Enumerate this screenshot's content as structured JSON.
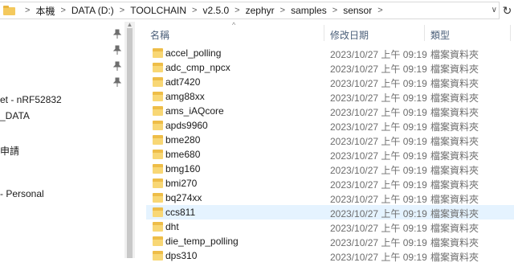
{
  "address_bar": {
    "crumbs": [
      "本機",
      "DATA (D:)",
      "TOOLCHAIN",
      "v2.5.0",
      "zephyr",
      "samples",
      "sensor"
    ],
    "separator": ">",
    "dropdown_glyph": "∨",
    "refresh_glyph": "↻"
  },
  "nav_pane": {
    "items": [
      {
        "label": "et - nRF52832"
      },
      {
        "label": "_DATA"
      },
      {
        "label": "申請"
      },
      {
        "label": "- Personal"
      }
    ],
    "pin_glyph": "📌"
  },
  "columns": {
    "name": "名稱",
    "modified": "修改日期",
    "type": "類型",
    "sort_glyph": "^"
  },
  "files": [
    {
      "name": "accel_polling",
      "modified": "2023/10/27 上午 09:19",
      "type": "檔案資料夾"
    },
    {
      "name": "adc_cmp_npcx",
      "modified": "2023/10/27 上午 09:19",
      "type": "檔案資料夾"
    },
    {
      "name": "adt7420",
      "modified": "2023/10/27 上午 09:19",
      "type": "檔案資料夾"
    },
    {
      "name": "amg88xx",
      "modified": "2023/10/27 上午 09:19",
      "type": "檔案資料夾"
    },
    {
      "name": "ams_iAQcore",
      "modified": "2023/10/27 上午 09:19",
      "type": "檔案資料夾"
    },
    {
      "name": "apds9960",
      "modified": "2023/10/27 上午 09:19",
      "type": "檔案資料夾"
    },
    {
      "name": "bme280",
      "modified": "2023/10/27 上午 09:19",
      "type": "檔案資料夾"
    },
    {
      "name": "bme680",
      "modified": "2023/10/27 上午 09:19",
      "type": "檔案資料夾"
    },
    {
      "name": "bmg160",
      "modified": "2023/10/27 上午 09:19",
      "type": "檔案資料夾"
    },
    {
      "name": "bmi270",
      "modified": "2023/10/27 上午 09:19",
      "type": "檔案資料夾"
    },
    {
      "name": "bq274xx",
      "modified": "2023/10/27 上午 09:19",
      "type": "檔案資料夾"
    },
    {
      "name": "ccs811",
      "modified": "2023/10/27 上午 09:19",
      "type": "檔案資料夾"
    },
    {
      "name": "dht",
      "modified": "2023/10/27 上午 09:19",
      "type": "檔案資料夾"
    },
    {
      "name": "die_temp_polling",
      "modified": "2023/10/27 上午 09:19",
      "type": "檔案資料夾"
    },
    {
      "name": "dps310",
      "modified": "2023/10/27 上午 09:19",
      "type": "檔案資料夾"
    }
  ],
  "hover_row_index": 11,
  "colors": {
    "folder": "#f8d775",
    "hover_row": "#e5f3ff",
    "header_text": "#4c607a"
  }
}
